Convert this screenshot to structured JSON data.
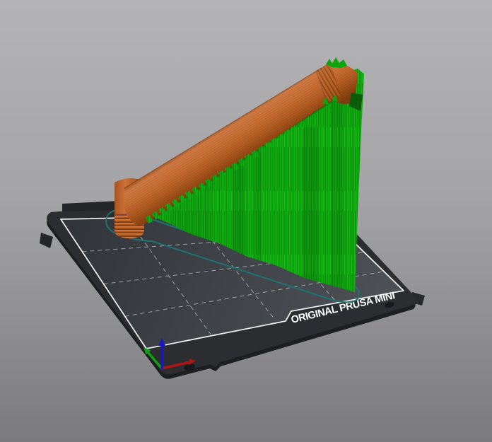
{
  "viewport": {
    "bed_label": "ORIGINAL PRUSA MINI"
  },
  "colors": {
    "background_top": "#b4b4b6",
    "background_bottom": "#7b7b7d",
    "bed_rim": "#2b2d30",
    "bed_surface_dark": "#313438",
    "bed_surface_light": "#4c5055",
    "bed_border": "#ededed",
    "bed_grid": "#ffffff",
    "bed_label_text": "#ffffff",
    "model_body": "#c1662e",
    "support": "#10ab10",
    "skirt": "#1e7474",
    "axis_x": "#b01515",
    "axis_y": "#12a012",
    "axis_z": "#1818c0"
  }
}
